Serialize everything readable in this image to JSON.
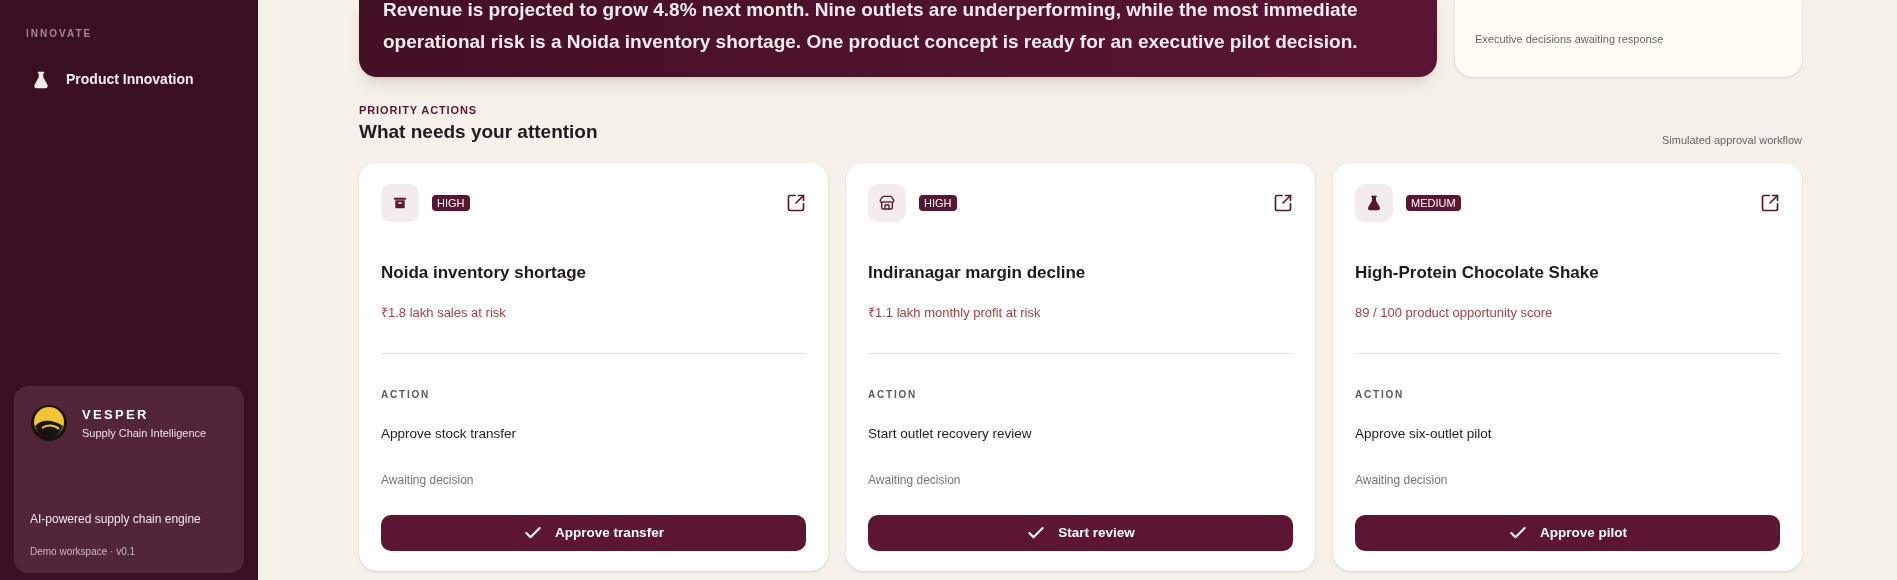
{
  "sidebar": {
    "section_label": "INNOVATE",
    "items": [
      {
        "label": "Product Innovation",
        "kind": "flask"
      }
    ],
    "brand_card": {
      "name": "VESPER",
      "tagline": "Supply Chain Intelligence",
      "description": "AI-powered supply chain engine",
      "footer": "Demo workspace · v0.1"
    }
  },
  "summary_banner": {
    "lines": [
      "Revenue is projected to grow 4.8% next month. Nine outlets are underperforming, while the most immediate",
      "operational risk is a Noida inventory shortage. One product concept is ready for an executive pilot decision."
    ]
  },
  "stat_card": {
    "caption": "Executive decisions awaiting response"
  },
  "priority_section": {
    "eyebrow": "PRIORITY ACTIONS",
    "title": "What needs your attention",
    "note": "Simulated approval workflow"
  },
  "action_cards": [
    {
      "kind": "archive",
      "priority": "HIGH",
      "title": "Noida inventory shortage",
      "impact": "₹1.8 lakh sales at risk",
      "action_label": "ACTION",
      "action": "Approve stock transfer",
      "status": "Awaiting decision",
      "button": "Approve transfer"
    },
    {
      "kind": "store",
      "priority": "HIGH",
      "title": "Indiranagar margin decline",
      "impact": "₹1.1 lakh monthly profit at risk",
      "action_label": "ACTION",
      "action": "Start outlet recovery review",
      "status": "Awaiting decision",
      "button": "Start review"
    },
    {
      "kind": "flask",
      "priority": "MEDIUM",
      "title": "High-Protein Chocolate Shake",
      "impact": "89 / 100 product opportunity score",
      "action_label": "ACTION",
      "action": "Approve six-outlet pilot",
      "status": "Awaiting decision",
      "button": "Approve pilot"
    }
  ]
}
